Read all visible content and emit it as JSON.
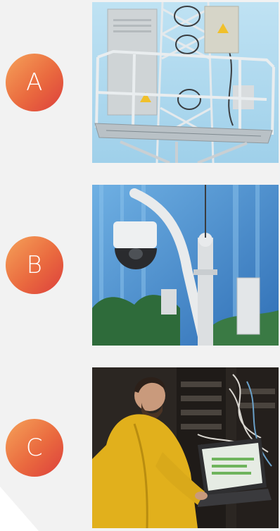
{
  "options": [
    {
      "letter": "A",
      "photo_icon": "telecom-tower-platform-photo-icon",
      "colors": {
        "sky": "#a9d6ec",
        "steel": "#d7dee3",
        "cabinet": "#ced3d5",
        "warning": "#f0c02b"
      }
    },
    {
      "letter": "B",
      "photo_icon": "dome-camera-on-pole-photo-icon",
      "colors": {
        "glass": "#4a90d0",
        "pole": "#e6e8ea",
        "trees": "#2f6a3c"
      }
    },
    {
      "letter": "C",
      "photo_icon": "technician-in-server-room-photo-icon",
      "colors": {
        "jacket": "#e2b21d",
        "rack": "#2a2521",
        "screen": "#6fb45d"
      }
    }
  ],
  "badge_gradient": [
    "#f5a259",
    "#ea6a3f",
    "#dc3f3c"
  ],
  "panel_color": "#f2f2f2"
}
